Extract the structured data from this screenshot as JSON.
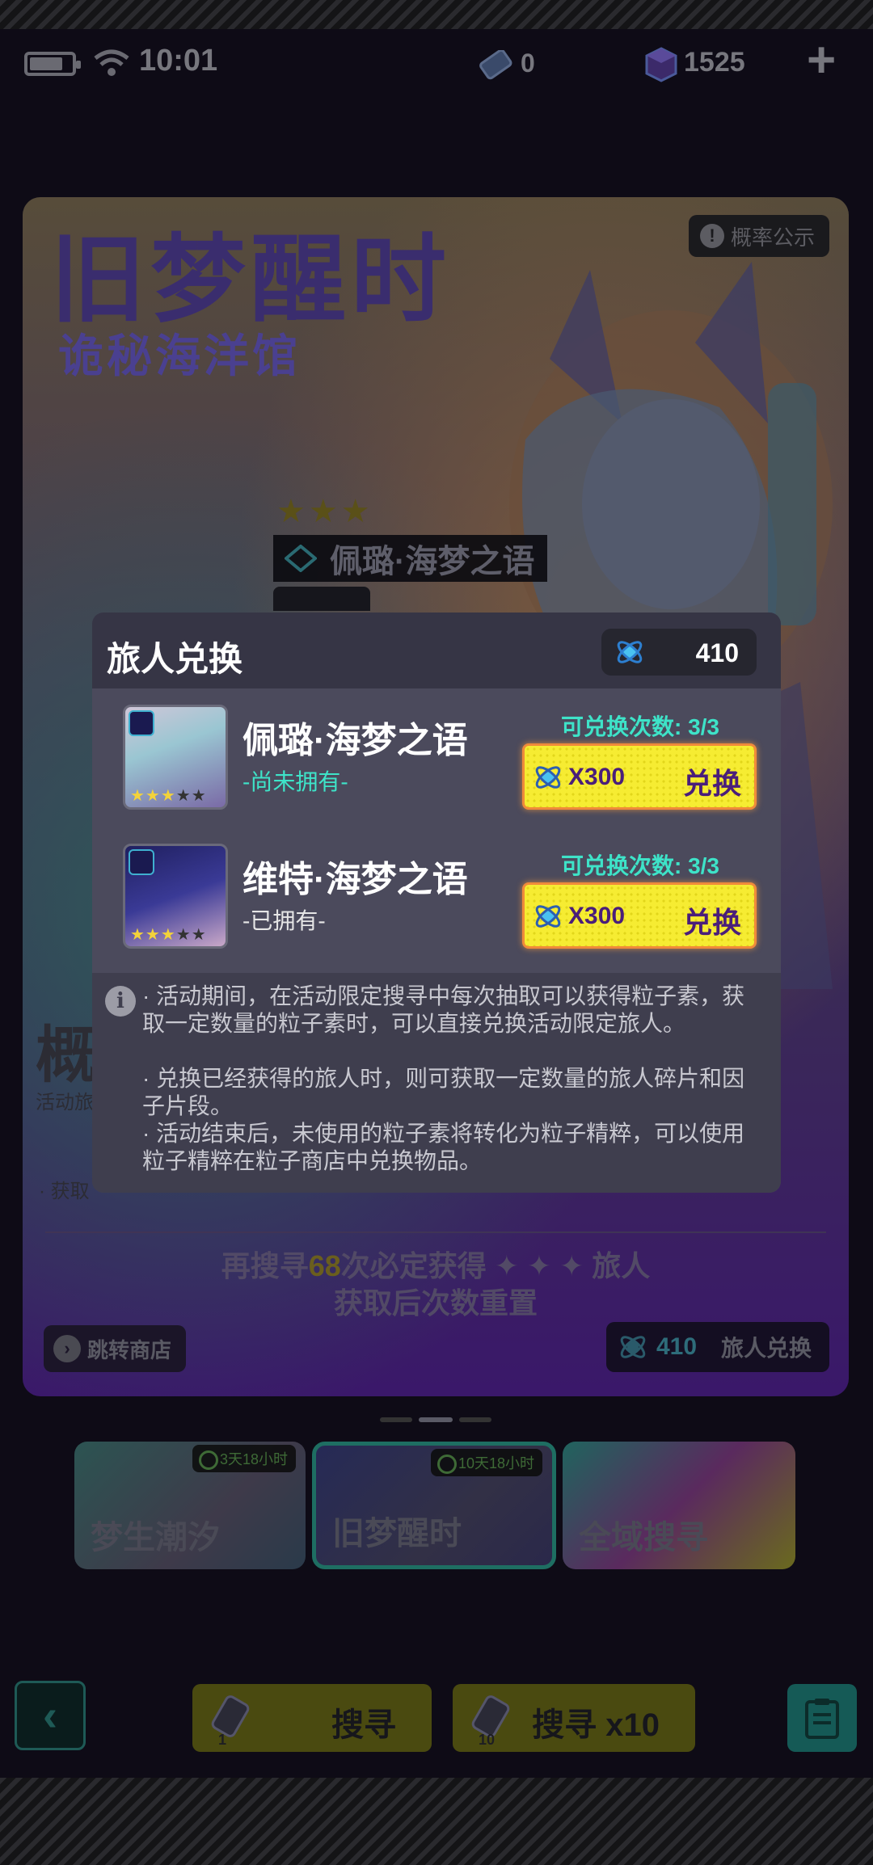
{
  "status_bar": {
    "time": "10:01",
    "ticket_count": "0",
    "crystal_count": "1525",
    "plus_label": "+"
  },
  "banner": {
    "title": "旧梦醒时",
    "subtitle": "诡秘海洋馆",
    "probability_button": "概率公示",
    "stars": "★★★",
    "featured_name": "佩璐·海梦之语",
    "side_partial_text": "概",
    "side_small_text": "活动旅",
    "side_bullet_text": "· 获取",
    "pity_prefix": "再搜寻",
    "pity_count": "68",
    "pity_suffix": "次必定获得 ✦ ✦ ✦ 旅人",
    "pity_line2": "获取后次数重置",
    "shop_button": "跳转商店",
    "exchange_count": "410",
    "exchange_button": "旅人兑换"
  },
  "event_tabs": [
    {
      "label": "梦生潮汐",
      "timer": "3天18小时"
    },
    {
      "label": "旧梦醒时",
      "timer": "10天18小时"
    },
    {
      "label": "全域搜寻",
      "timer": ""
    }
  ],
  "bottom": {
    "back_glyph": "‹",
    "search_single_label": "搜寻",
    "search_single_count": "1",
    "search_ten_label": "搜寻 x10",
    "search_ten_count": "10"
  },
  "modal": {
    "title": "旅人兑换",
    "balance": "410",
    "items": [
      {
        "name": "佩璐·海梦之语",
        "status": "-尚未拥有-",
        "count_label": "可兑换次数: 3/3",
        "cost": "X300",
        "button": "兑换"
      },
      {
        "name": "维特·海梦之语",
        "status": "-已拥有-",
        "count_label": "可兑换次数: 3/3",
        "cost": "X300",
        "button": "兑换"
      }
    ],
    "info_glyph": "i",
    "notes": [
      "· 活动期间，在活动限定搜寻中每次抽取可以获得粒子素，获取一定数量的粒子素时，可以直接兑换活动限定旅人。",
      "· 兑换已经获得的旅人时，则可获取一定数量的旅人碎片和因子片段。",
      "· 活动结束后，未使用的粒子素将转化为粒子精粹，可以使用粒子精粹在粒子商店中兑换物品。"
    ]
  }
}
